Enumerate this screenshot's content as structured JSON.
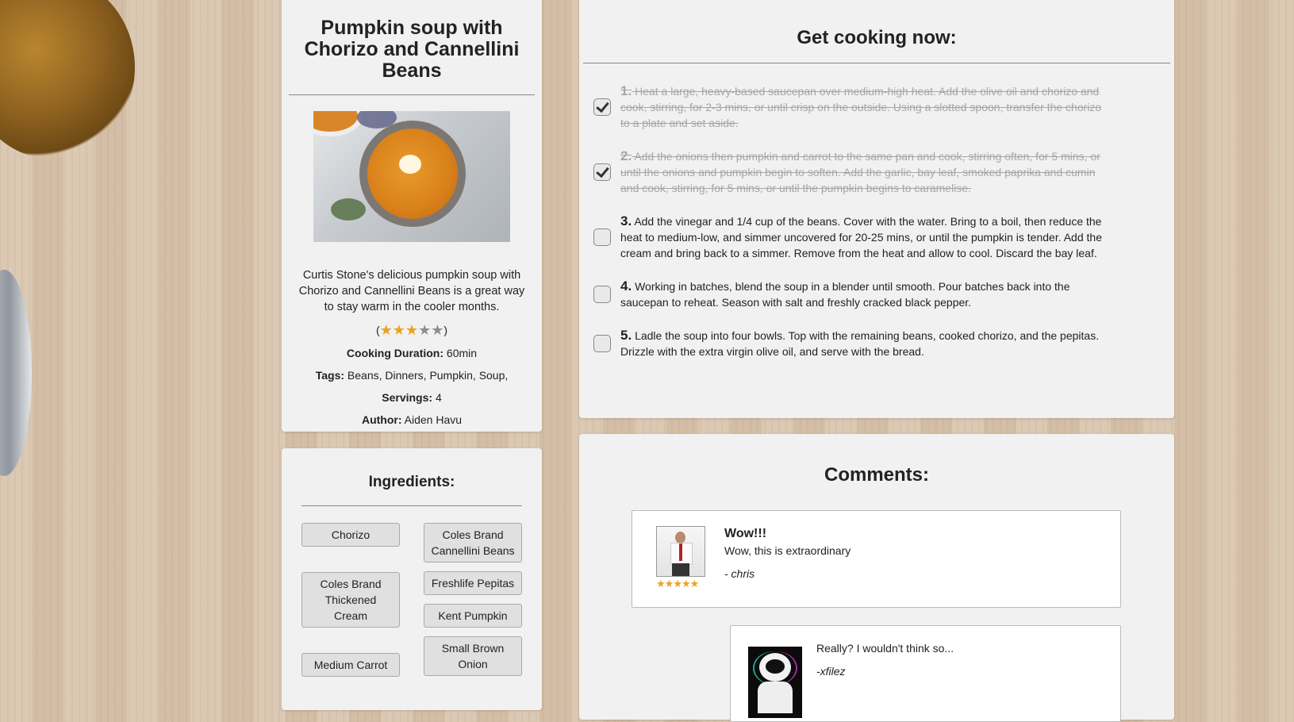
{
  "recipe": {
    "title": "Pumpkin soup with Chorizo and Cannellini Beans",
    "description": "Curtis Stone's delicious pumpkin soup with Chorizo and Cannellini Beans is a great way to stay warm in the cooler months.",
    "rating": {
      "value": 3,
      "max": 5,
      "open": "(",
      "close": ")"
    },
    "cooking_duration_label": "Cooking Duration:",
    "cooking_duration": "60min",
    "tags_label": "Tags:",
    "tags": [
      "Beans",
      "Dinners",
      "Pumpkin",
      "Soup"
    ],
    "servings_label": "Servings:",
    "servings": "4",
    "author_label": "Author:",
    "author": "Aiden Havu"
  },
  "ingredients": {
    "title": "Ingredients:",
    "left": [
      "Chorizo",
      "Coles Brand Thickened Cream",
      "Medium Carrot"
    ],
    "right": [
      "Coles Brand Cannellini Beans",
      "Freshlife Pepitas",
      "Kent Pumpkin",
      "Small Brown Onion"
    ]
  },
  "steps": {
    "title": "Get cooking now:",
    "items": [
      {
        "num": "1.",
        "checked": true,
        "text": "Heat a large, heavy-based saucepan over medium-high heat. Add the olive oil and chorizo and cook, stirring, for 2-3 mins, or until crisp on the outside. Using a slotted spoon, transfer the chorizo to a plate and set aside."
      },
      {
        "num": "2.",
        "checked": true,
        "text": "Add the onions then pumpkin and carrot to the same pan and cook, stirring often, for 5 mins, or until the onions and pumpkin begin to soften. Add the garlic, bay leaf, smoked paprika and cumin and cook, stirring, for 5 mins, or until the pumpkin begins to caramelise."
      },
      {
        "num": "3.",
        "checked": false,
        "text": "Add the vinegar and 1/4 cup of the beans. Cover with the water. Bring to a boil, then reduce the heat to medium-low, and simmer uncovered for 20-25 mins, or until the pumpkin is tender. Add the cream and bring back to a simmer. Remove from the heat and allow to cool. Discard the bay leaf."
      },
      {
        "num": "4.",
        "checked": false,
        "text": "Working in batches, blend the soup in a blender until smooth. Pour batches back into the saucepan to reheat. Season with salt and freshly cracked black pepper."
      },
      {
        "num": "5.",
        "checked": false,
        "text": "Ladle the soup into four bowls. Top with the remaining beans, cooked chorizo, and the pepitas. Drizzle with the extra virgin olive oil, and serve with the bread."
      }
    ]
  },
  "comments": {
    "title": "Comments:",
    "items": [
      {
        "title": "Wow!!!",
        "body": "Wow, this is extraordinary",
        "author": "- chris",
        "stars": 5
      },
      {
        "body": "Really? I wouldn't think so...",
        "author": "-xfilez"
      }
    ]
  },
  "colors": {
    "star_on": "#e9a41c",
    "star_off": "#8d8d8d",
    "done_text": "#a6a6a6"
  }
}
